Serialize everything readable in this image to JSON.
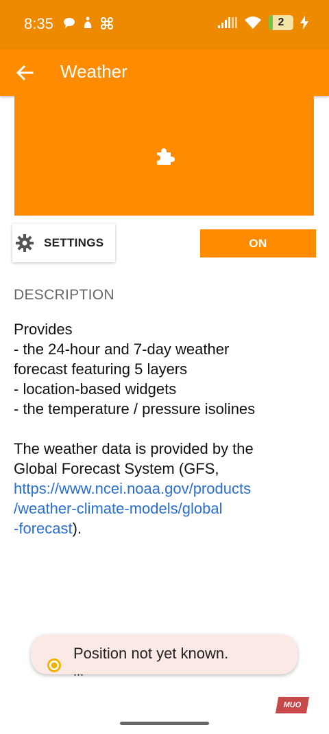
{
  "status_bar": {
    "time": "8:35",
    "battery_level": "2",
    "icons_left": [
      "chat-icon",
      "accessibility-icon",
      "pinwheel-icon"
    ],
    "icons_right": [
      "signal-icon",
      "wifi-icon",
      "battery-icon",
      "charging-icon"
    ]
  },
  "app_bar": {
    "title": "Weather",
    "back_icon": "back-arrow-icon",
    "color": "#ff8c00"
  },
  "hero": {
    "icon": "puzzle-icon"
  },
  "actions": {
    "settings_label": "SETTINGS",
    "settings_icon": "gear-icon",
    "toggle_label": "ON"
  },
  "description": {
    "heading": "DESCRIPTION",
    "lines": [
      "Provides",
      "- the 24-hour and 7-day weather",
      "forecast featuring 5 layers",
      "- location-based widgets",
      "- the temperature / pressure isolines"
    ],
    "source_line1": "The weather data is provided by the",
    "source_line2": "Global Forecast System (GFS,",
    "link_line1": "https://www.ncei.noaa.gov/products",
    "link_line2": "/weather-climate-models/global",
    "link_line3": "-forecast",
    "after_link": ")."
  },
  "toast": {
    "icon": "location-pin-icon",
    "message": "Position not yet known.",
    "detail": "..."
  },
  "watermark": {
    "text": "MUO"
  },
  "colors": {
    "accent": "#ff8c00",
    "status_bar": "#ee8a00",
    "link": "#2a6fcf",
    "toast_bg": "#fbe9e6"
  }
}
